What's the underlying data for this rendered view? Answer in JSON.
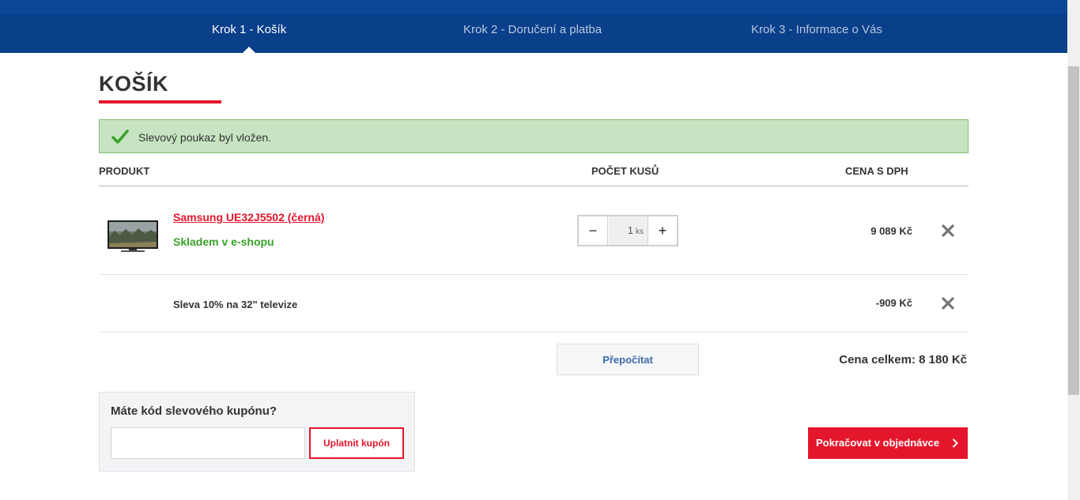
{
  "steps": [
    {
      "label": "Krok 1 - Košík",
      "active": true
    },
    {
      "label": "Krok 2 - Doručení a platba",
      "active": false
    },
    {
      "label": "Krok 3 - Informace o Vás",
      "active": false
    }
  ],
  "page": {
    "title": "KOŠÍK"
  },
  "alert": {
    "message": "Slevový poukaz byl vložen.",
    "icon": "check-icon"
  },
  "table": {
    "headers": {
      "product": "PRODUKT",
      "quantity": "POČET KUSŮ",
      "price": "CENA S DPH"
    },
    "items": [
      {
        "name": "Samsung UE32J5502 (černá)",
        "stock": "Skladem v e-shopu",
        "quantity": "1",
        "unit": "ks",
        "price": "9 089 Kč"
      }
    ],
    "discounts": [
      {
        "name": "Sleva 10% na 32\" televize",
        "price": "-909 Kč"
      }
    ]
  },
  "actions": {
    "recalculate": "Přepočítat",
    "total": "Cena celkem: 8 180 Kč",
    "continue": "Pokračovat v objednávce"
  },
  "coupon": {
    "title": "Máte kód slevového kupónu?",
    "input_value": "",
    "apply": "Uplatnit kupón"
  },
  "colors": {
    "brand_blue": "#0a3f8a",
    "accent_red": "#e4162b",
    "success_green": "#3aa12b",
    "alert_bg": "#c6e4c1"
  }
}
